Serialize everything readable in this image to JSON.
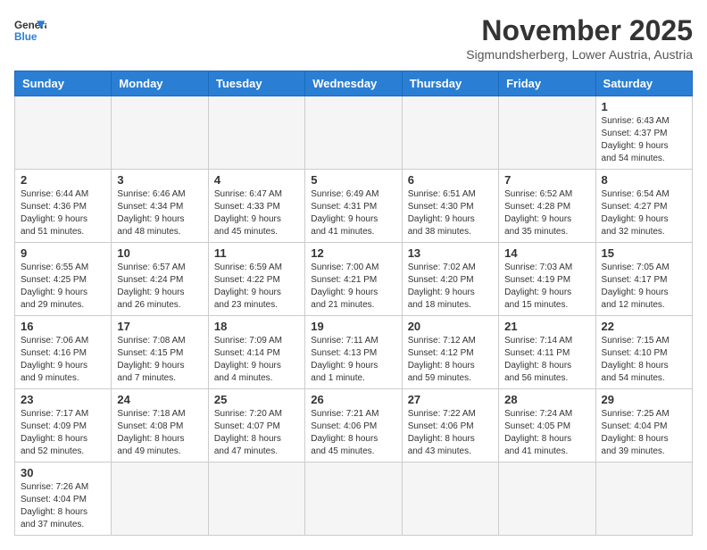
{
  "logo": {
    "text_general": "General",
    "text_blue": "Blue"
  },
  "header": {
    "month_year": "November 2025",
    "location": "Sigmundsherberg, Lower Austria, Austria"
  },
  "weekdays": [
    "Sunday",
    "Monday",
    "Tuesday",
    "Wednesday",
    "Thursday",
    "Friday",
    "Saturday"
  ],
  "weeks": [
    [
      {
        "day": "",
        "info": ""
      },
      {
        "day": "",
        "info": ""
      },
      {
        "day": "",
        "info": ""
      },
      {
        "day": "",
        "info": ""
      },
      {
        "day": "",
        "info": ""
      },
      {
        "day": "",
        "info": ""
      },
      {
        "day": "1",
        "info": "Sunrise: 6:43 AM\nSunset: 4:37 PM\nDaylight: 9 hours\nand 54 minutes."
      }
    ],
    [
      {
        "day": "2",
        "info": "Sunrise: 6:44 AM\nSunset: 4:36 PM\nDaylight: 9 hours\nand 51 minutes."
      },
      {
        "day": "3",
        "info": "Sunrise: 6:46 AM\nSunset: 4:34 PM\nDaylight: 9 hours\nand 48 minutes."
      },
      {
        "day": "4",
        "info": "Sunrise: 6:47 AM\nSunset: 4:33 PM\nDaylight: 9 hours\nand 45 minutes."
      },
      {
        "day": "5",
        "info": "Sunrise: 6:49 AM\nSunset: 4:31 PM\nDaylight: 9 hours\nand 41 minutes."
      },
      {
        "day": "6",
        "info": "Sunrise: 6:51 AM\nSunset: 4:30 PM\nDaylight: 9 hours\nand 38 minutes."
      },
      {
        "day": "7",
        "info": "Sunrise: 6:52 AM\nSunset: 4:28 PM\nDaylight: 9 hours\nand 35 minutes."
      },
      {
        "day": "8",
        "info": "Sunrise: 6:54 AM\nSunset: 4:27 PM\nDaylight: 9 hours\nand 32 minutes."
      }
    ],
    [
      {
        "day": "9",
        "info": "Sunrise: 6:55 AM\nSunset: 4:25 PM\nDaylight: 9 hours\nand 29 minutes."
      },
      {
        "day": "10",
        "info": "Sunrise: 6:57 AM\nSunset: 4:24 PM\nDaylight: 9 hours\nand 26 minutes."
      },
      {
        "day": "11",
        "info": "Sunrise: 6:59 AM\nSunset: 4:22 PM\nDaylight: 9 hours\nand 23 minutes."
      },
      {
        "day": "12",
        "info": "Sunrise: 7:00 AM\nSunset: 4:21 PM\nDaylight: 9 hours\nand 21 minutes."
      },
      {
        "day": "13",
        "info": "Sunrise: 7:02 AM\nSunset: 4:20 PM\nDaylight: 9 hours\nand 18 minutes."
      },
      {
        "day": "14",
        "info": "Sunrise: 7:03 AM\nSunset: 4:19 PM\nDaylight: 9 hours\nand 15 minutes."
      },
      {
        "day": "15",
        "info": "Sunrise: 7:05 AM\nSunset: 4:17 PM\nDaylight: 9 hours\nand 12 minutes."
      }
    ],
    [
      {
        "day": "16",
        "info": "Sunrise: 7:06 AM\nSunset: 4:16 PM\nDaylight: 9 hours\nand 9 minutes."
      },
      {
        "day": "17",
        "info": "Sunrise: 7:08 AM\nSunset: 4:15 PM\nDaylight: 9 hours\nand 7 minutes."
      },
      {
        "day": "18",
        "info": "Sunrise: 7:09 AM\nSunset: 4:14 PM\nDaylight: 9 hours\nand 4 minutes."
      },
      {
        "day": "19",
        "info": "Sunrise: 7:11 AM\nSunset: 4:13 PM\nDaylight: 9 hours\nand 1 minute."
      },
      {
        "day": "20",
        "info": "Sunrise: 7:12 AM\nSunset: 4:12 PM\nDaylight: 8 hours\nand 59 minutes."
      },
      {
        "day": "21",
        "info": "Sunrise: 7:14 AM\nSunset: 4:11 PM\nDaylight: 8 hours\nand 56 minutes."
      },
      {
        "day": "22",
        "info": "Sunrise: 7:15 AM\nSunset: 4:10 PM\nDaylight: 8 hours\nand 54 minutes."
      }
    ],
    [
      {
        "day": "23",
        "info": "Sunrise: 7:17 AM\nSunset: 4:09 PM\nDaylight: 8 hours\nand 52 minutes."
      },
      {
        "day": "24",
        "info": "Sunrise: 7:18 AM\nSunset: 4:08 PM\nDaylight: 8 hours\nand 49 minutes."
      },
      {
        "day": "25",
        "info": "Sunrise: 7:20 AM\nSunset: 4:07 PM\nDaylight: 8 hours\nand 47 minutes."
      },
      {
        "day": "26",
        "info": "Sunrise: 7:21 AM\nSunset: 4:06 PM\nDaylight: 8 hours\nand 45 minutes."
      },
      {
        "day": "27",
        "info": "Sunrise: 7:22 AM\nSunset: 4:06 PM\nDaylight: 8 hours\nand 43 minutes."
      },
      {
        "day": "28",
        "info": "Sunrise: 7:24 AM\nSunset: 4:05 PM\nDaylight: 8 hours\nand 41 minutes."
      },
      {
        "day": "29",
        "info": "Sunrise: 7:25 AM\nSunset: 4:04 PM\nDaylight: 8 hours\nand 39 minutes."
      }
    ],
    [
      {
        "day": "30",
        "info": "Sunrise: 7:26 AM\nSunset: 4:04 PM\nDaylight: 8 hours\nand 37 minutes."
      },
      {
        "day": "",
        "info": ""
      },
      {
        "day": "",
        "info": ""
      },
      {
        "day": "",
        "info": ""
      },
      {
        "day": "",
        "info": ""
      },
      {
        "day": "",
        "info": ""
      },
      {
        "day": "",
        "info": ""
      }
    ]
  ]
}
